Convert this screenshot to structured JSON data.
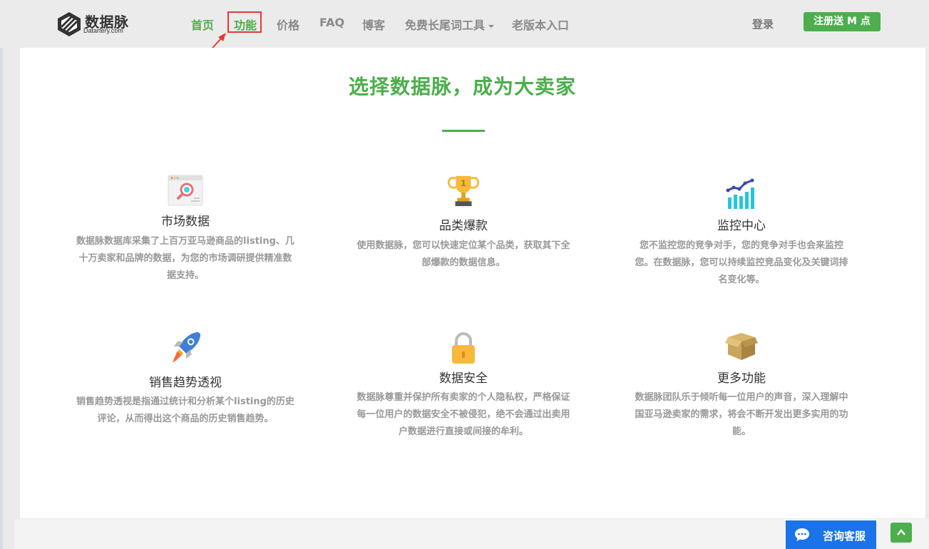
{
  "brand": {
    "name": "数据脉",
    "domain": "Datartery.com"
  },
  "nav": {
    "items": [
      {
        "label": "首页"
      },
      {
        "label": "功能"
      },
      {
        "label": "价格"
      },
      {
        "label": "FAQ"
      },
      {
        "label": "博客"
      },
      {
        "label": "免费长尾词工具"
      },
      {
        "label": "老版本入口"
      }
    ],
    "login": "登录",
    "register": "注册送 M 点"
  },
  "hero": {
    "title": "选择数据脉，成为大卖家"
  },
  "features": [
    {
      "icon": "market-search-icon",
      "title": "市场数据",
      "desc": [
        "数据脉数据库采集了上百万亚马逊商品的listing、几",
        "十万卖家和品牌的数据，为您的市场调研提供精准数",
        "据支持。"
      ]
    },
    {
      "icon": "trophy-icon",
      "title": "品类爆款",
      "desc": [
        "使用数据脉，您可以快速定位某个品类，获取其下全",
        "部爆款的数据信息。"
      ]
    },
    {
      "icon": "bar-chart-icon",
      "title": "监控中心",
      "desc": [
        "您不监控您的竞争对手，您的竞争对手也会来监控",
        "您。在数据脉，您可以持续监控竞品变化及关键词排",
        "名变化等。"
      ]
    },
    {
      "icon": "rocket-icon",
      "title": "销售趋势透视",
      "desc": [
        "销售趋势透视是指通过统计和分析某个listing的历史",
        "评论，从而得出这个商品的历史销售趋势。"
      ]
    },
    {
      "icon": "lock-icon",
      "title": "数据安全",
      "desc": [
        "数据脉尊重并保护所有卖家的个人隐私权，严格保证",
        "每一位用户的数据安全不被侵犯，绝不会通过出卖用",
        "户数据进行直接或间接的牟利。"
      ]
    },
    {
      "icon": "box-icon",
      "title": "更多功能",
      "desc": [
        "数据脉团队乐于倾听每一位用户的声音，深入理解中",
        "国亚马逊卖家的需求，将会不断开发出更多实用的功",
        "能。"
      ]
    }
  ],
  "support": {
    "chat_label": "咨询客服"
  },
  "colors": {
    "accent": "#4cae4c",
    "highlight": "#e53935",
    "chat": "#1a73e8"
  }
}
